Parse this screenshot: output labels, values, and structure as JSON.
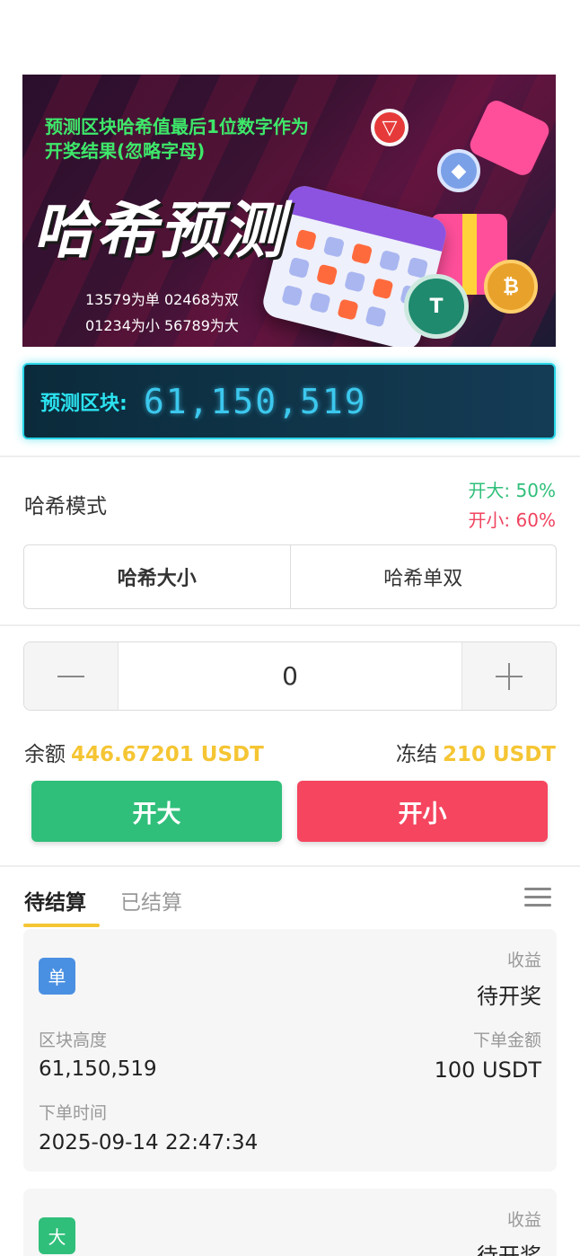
{
  "banner": {
    "top_text": "预测区块哈希值最后1位数字作为开奖结果(忽略字母)",
    "title": "哈希预测",
    "rule1": "13579为单 02468为双",
    "rule2": "01234为小 56789为大"
  },
  "predict": {
    "label": "预测区块:",
    "block": "61,150,519"
  },
  "mode": {
    "label": "哈希模式",
    "odds_big": "开大: 50%",
    "odds_small": "开小: 60%",
    "tabs": [
      "哈希大小",
      "哈希单双"
    ],
    "active_tab": "哈希大小"
  },
  "stepper": {
    "value": "0"
  },
  "wallet": {
    "balance_label": "余额",
    "balance_value": "446.67201 USDT",
    "frozen_label": "冻结",
    "frozen_value": "210 USDT"
  },
  "actions": {
    "big": "开大",
    "small": "开小"
  },
  "tabs": {
    "pending": "待结算",
    "settled": "已结算"
  },
  "orders": [
    {
      "badge": "单",
      "profit_label": "收益",
      "profit_value": "待开奖",
      "height_label": "区块高度",
      "height_value": "61,150,519",
      "amount_label": "下单金额",
      "amount_value": "100 USDT",
      "time_label": "下单时间",
      "time_value": "2025-09-14 22:47:34"
    },
    {
      "badge": "大",
      "profit_label": "收益",
      "profit_value": "待开奖"
    }
  ],
  "colors": {
    "green": "#2fbf7a",
    "red": "#f5455f",
    "gold": "#f5c533",
    "cyan": "#29d6e8",
    "blue_badge": "#4a90e2"
  }
}
